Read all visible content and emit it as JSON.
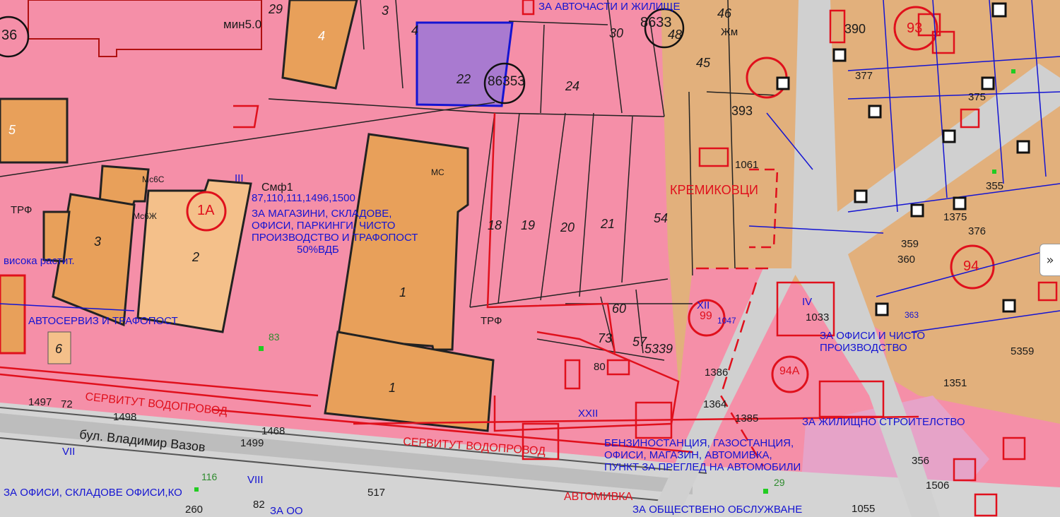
{
  "map": {
    "street_name": "бул. Владимир Вазов",
    "district": "КРЕМИКОВЦИ",
    "colors": {
      "zone_pink": "#f58fa8",
      "building_orange": "#e8a05a",
      "building_light": "#f4c08a",
      "plot_purple": "#a97ad0",
      "tan_zone": "#e2b07c",
      "road_gray": "#cfcfcf",
      "red_line": "#e0101c",
      "blue_line": "#1414d2"
    },
    "plot_numbers": [
      "29",
      "3",
      "4",
      "22",
      "24",
      "30",
      "46",
      "48",
      "45",
      "5",
      "4",
      "18",
      "19",
      "20",
      "21",
      "54",
      "60",
      "73",
      "57",
      "5339",
      "1497",
      "1498",
      "1499",
      "1468",
      "517",
      "1055",
      "1386",
      "1385",
      "1364",
      "356",
      "83",
      "116"
    ],
    "circle_labels": {
      "c1": "8633",
      "c2": "86353",
      "c3": "36",
      "c4": "1А",
      "c5": "93",
      "c6": "94"
    },
    "labels": {
      "top_shop": "ЗА АВТОЧАСТИ И ЖИЛИЩЕ",
      "min5": "мин5.0",
      "smf1": "Смф1",
      "smf1_codes": "87,110,111,1496,1500",
      "zone_text_1": "ЗА МАГАЗИНИ, СКЛАДОВЕ,",
      "zone_text_2": "ОФИСИ, ПАРКИНГИ, ЧИСТО",
      "zone_text_3": "ПРОИЗВОДСТВО И ТРАФОПОСТ",
      "zone_text_4": "50%ВДБ",
      "trf1": "ТРФ",
      "trf2": "ТРФ",
      "visoka": "висока растит.",
      "trafopost2": "АВТОСЕРВИЗ И ТРАФОПОСТ",
      "servitut1": "СЕРВИТУТ ВОДОПРОВОД",
      "servitut2": "СЕРВИТУТ ВОДОПРОВОД",
      "gaz1": "БЕНЗИНОСТАНЦИЯ, ГАЗОСТАНЦИЯ,",
      "gaz2": "ОФИСИ, МАГАЗИН, АВТОМИВКА,",
      "gaz3": "ПУНКТ ЗА ПРЕГЛЕД НА АВТОМОБИЛИ",
      "public": "ЗА ОБЩЕСТВЕНО ОБСЛУЖВАНЕ",
      "zhil": "ЗА ЖИЛИЩНО СТРОИТЕЛСТВО",
      "ofisi": "ЗА ОФИСИ И ЧИСТО",
      "proizv": "ПРОИЗВОДСТВО",
      "office_bottom": "ЗА ОФИСИ, СКЛАДОВЕ ОФИСИ,КО",
      "zaoo": "ЗА ОО",
      "avtomivka": "АВТОМИВКА",
      "mc": "МС",
      "zh": "Жм",
      "ms6s": "Мс6С",
      "ms6zh": "Мс6Ж",
      "roman_iii": "III",
      "roman_vii": "VII",
      "roman_viii": "VIII",
      "roman_xii": "XII",
      "roman_xxii": "XXII",
      "roman_iv": "IV",
      "label_99": "99",
      "label_1033": "1033",
      "label_1047": "1047",
      "label_1061": "1061",
      "label_393": "393",
      "label_390": "390",
      "label_94a": "94А",
      "label_260": "260",
      "label_82": "82",
      "label_80": "80",
      "label_72": "72",
      "label_1506": "1506",
      "label_5359": "5359",
      "label_1351": "1351",
      "label_29": "29",
      "label_377": "377",
      "label_376": "376",
      "label_375": "375",
      "label_1375": "1375",
      "label_355": "355",
      "label_360": "360",
      "label_359": "359",
      "label_363": "363"
    },
    "expand_button": "»"
  }
}
